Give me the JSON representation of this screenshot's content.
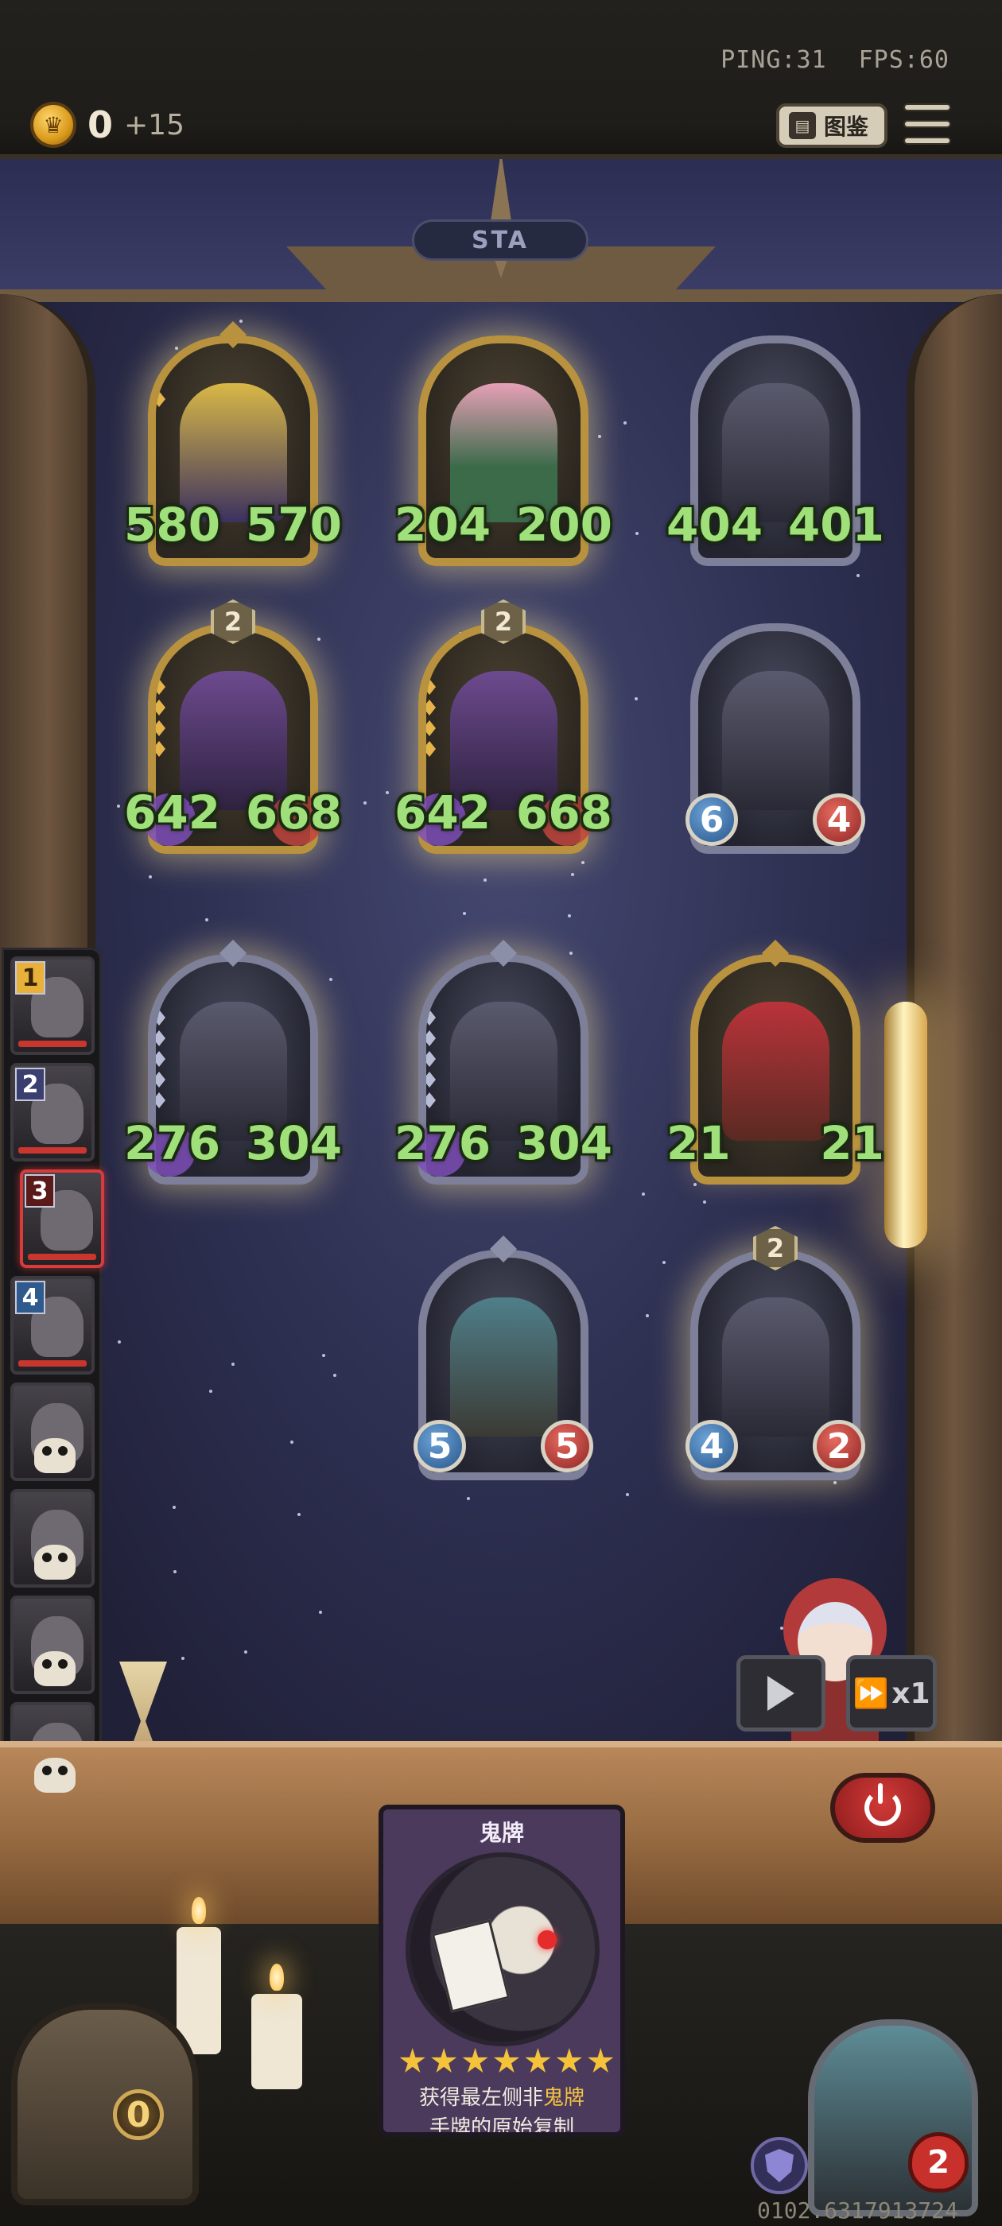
{
  "topbar": {
    "ping": "PING:31",
    "fps": "FPS:60",
    "gold": "0",
    "gold_income": "+15",
    "codex_label": "图鉴"
  },
  "board": {
    "stage_label": "STA",
    "minions": [
      {
        "id": "m1",
        "attack": "580",
        "health": "570",
        "frame": "gold",
        "tier": null
      },
      {
        "id": "m2",
        "attack": "204",
        "health": "200",
        "frame": "gold",
        "tier": null
      },
      {
        "id": "m3",
        "attack": "404",
        "health": "401",
        "frame": "silver",
        "tier": null
      },
      {
        "id": "m4",
        "attack": "642",
        "health": "668",
        "frame": "gold",
        "tier": "2"
      },
      {
        "id": "m5",
        "attack": "642",
        "health": "668",
        "frame": "gold",
        "tier": "2"
      },
      {
        "id": "m6",
        "attack": "6",
        "health": "4",
        "frame": "silver",
        "tier": null
      },
      {
        "id": "m7",
        "attack": "276",
        "health": "304",
        "frame": "silver",
        "tier": null
      },
      {
        "id": "m8",
        "attack": "276",
        "health": "304",
        "frame": "silver",
        "tier": null
      },
      {
        "id": "m9",
        "attack": "21",
        "health": "21",
        "frame": "gold",
        "tier": null
      },
      {
        "id": "m10",
        "attack": "5",
        "health": "5",
        "frame": "silver",
        "tier": null
      },
      {
        "id": "m11",
        "attack": "4",
        "health": "2",
        "frame": "silver",
        "tier": "2"
      }
    ]
  },
  "opponents": [
    {
      "rank": "1",
      "status": "alive"
    },
    {
      "rank": "2",
      "status": "alive"
    },
    {
      "rank": "3",
      "status": "current"
    },
    {
      "rank": "4",
      "status": "alive"
    },
    {
      "rank": "",
      "status": "eliminated"
    },
    {
      "rank": "",
      "status": "eliminated"
    },
    {
      "rank": "",
      "status": "eliminated"
    },
    {
      "rank": "",
      "status": "eliminated"
    }
  ],
  "controls": {
    "speed_label": "x1"
  },
  "hand_card": {
    "name": "鬼牌",
    "stars": 7,
    "desc_line1_prefix": "获得最左侧非",
    "desc_line1_highlight": "鬼牌",
    "desc_line2": "手牌的原始复制"
  },
  "player": {
    "chest_count": "0",
    "lives": "2"
  },
  "version": "0102.6317913724",
  "colors": {
    "stat_buffed": "#9fe07a",
    "attack_orb": "#28558a",
    "health_orb": "#8e2525",
    "active_opponent": "#d93a3a",
    "highlight_text": "#f3c343"
  }
}
